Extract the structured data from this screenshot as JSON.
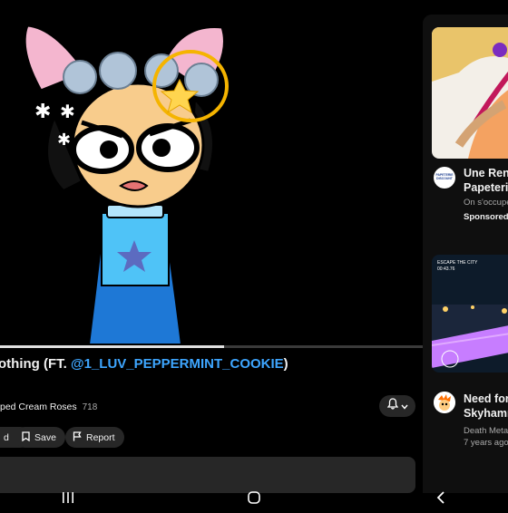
{
  "video": {
    "title_prefix": "othing (FT. ",
    "title_mention": "@1_LUV_PEPPERMINT_COOKIE",
    "title_suffix": ")",
    "progress": 0.53
  },
  "channel": {
    "name": "ped Cream Roses",
    "subscribers": "718"
  },
  "actions": {
    "download_label": "d",
    "save_label": "Save",
    "report_label": "Report"
  },
  "sidebar": {
    "cards": [
      {
        "title_line1": "Une Rent",
        "title_line2": "Papeterie",
        "sub": "On s'occupe",
        "sponsored": "Sponsored",
        "avatar_text": "PAPETERIE DISCOUNT"
      },
      {
        "title_line1": "Need for",
        "title_line2": "Skyhamm",
        "channel": "Death Meta",
        "age": "7 years ago",
        "thumb_text_1": "ESCAPE THE CITY",
        "thumb_text_2": "00:43.76"
      }
    ]
  },
  "colors": {
    "accent_link": "#3ea6ff",
    "pill_bg": "#272727",
    "dress": "#1e88e5"
  }
}
